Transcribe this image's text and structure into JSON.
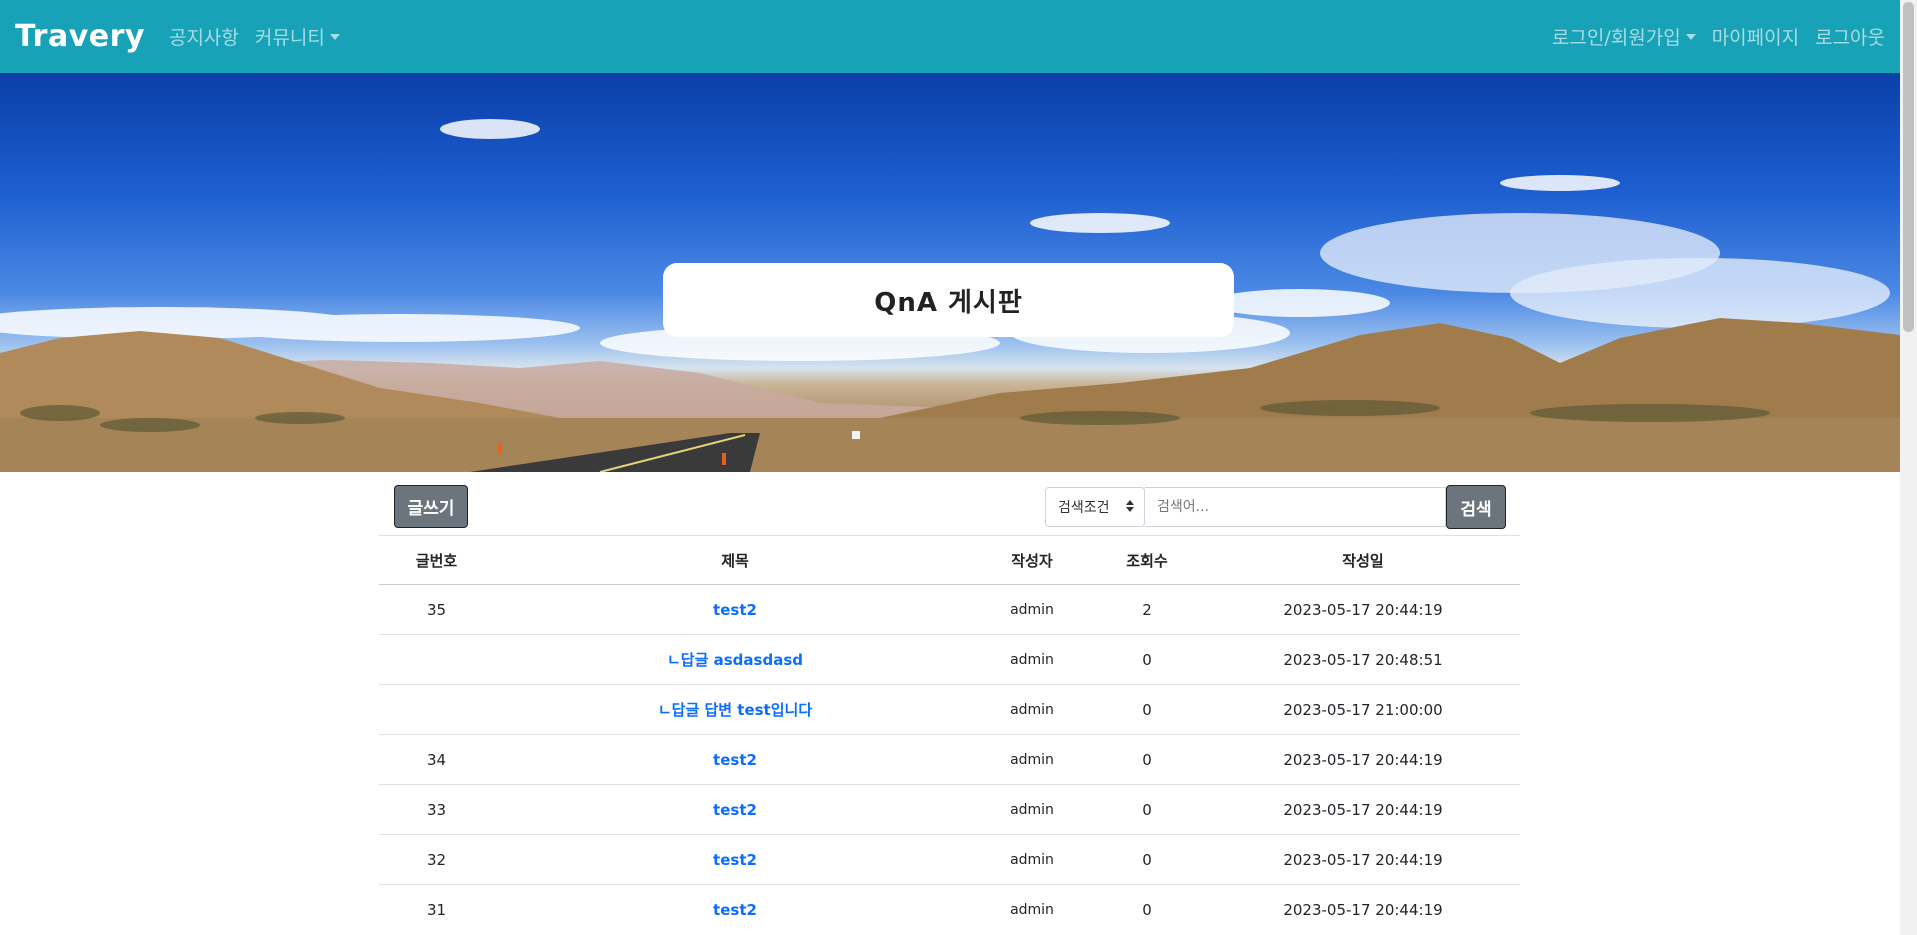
{
  "navbar": {
    "brand": "Travery",
    "left_items": [
      {
        "label": "공지사항",
        "dropdown": false
      },
      {
        "label": "커뮤니티",
        "dropdown": true
      }
    ],
    "right_items": [
      {
        "label": "로그인/회원가입",
        "dropdown": true
      },
      {
        "label": "마이페이지",
        "dropdown": false
      },
      {
        "label": "로그아웃",
        "dropdown": false
      }
    ],
    "background": "#17a2b8"
  },
  "hero": {
    "title": "QnA 게시판"
  },
  "toolbar": {
    "write_label": "글쓰기",
    "search_condition": "검색조건",
    "search_placeholder": "검색어...",
    "search_label": "검색"
  },
  "table": {
    "headers": [
      "글번호",
      "제목",
      "작성자",
      "조회수",
      "작성일"
    ],
    "rows": [
      {
        "no": "35",
        "title": "test2",
        "writer": "admin",
        "views": "2",
        "date": "2023-05-17 20:44:19"
      },
      {
        "no": "",
        "title": "ㄴ답글 asdasdasd",
        "writer": "admin",
        "views": "0",
        "date": "2023-05-17 20:48:51"
      },
      {
        "no": "",
        "title": "ㄴ답글 답변 test입니다",
        "writer": "admin",
        "views": "0",
        "date": "2023-05-17 21:00:00"
      },
      {
        "no": "34",
        "title": "test2",
        "writer": "admin",
        "views": "0",
        "date": "2023-05-17 20:44:19"
      },
      {
        "no": "33",
        "title": "test2",
        "writer": "admin",
        "views": "0",
        "date": "2023-05-17 20:44:19"
      },
      {
        "no": "32",
        "title": "test2",
        "writer": "admin",
        "views": "0",
        "date": "2023-05-17 20:44:19"
      },
      {
        "no": "31",
        "title": "test2",
        "writer": "admin",
        "views": "0",
        "date": "2023-05-17 20:44:19"
      }
    ]
  },
  "colors": {
    "link": "#0d6efd",
    "button": "#6c757d"
  }
}
